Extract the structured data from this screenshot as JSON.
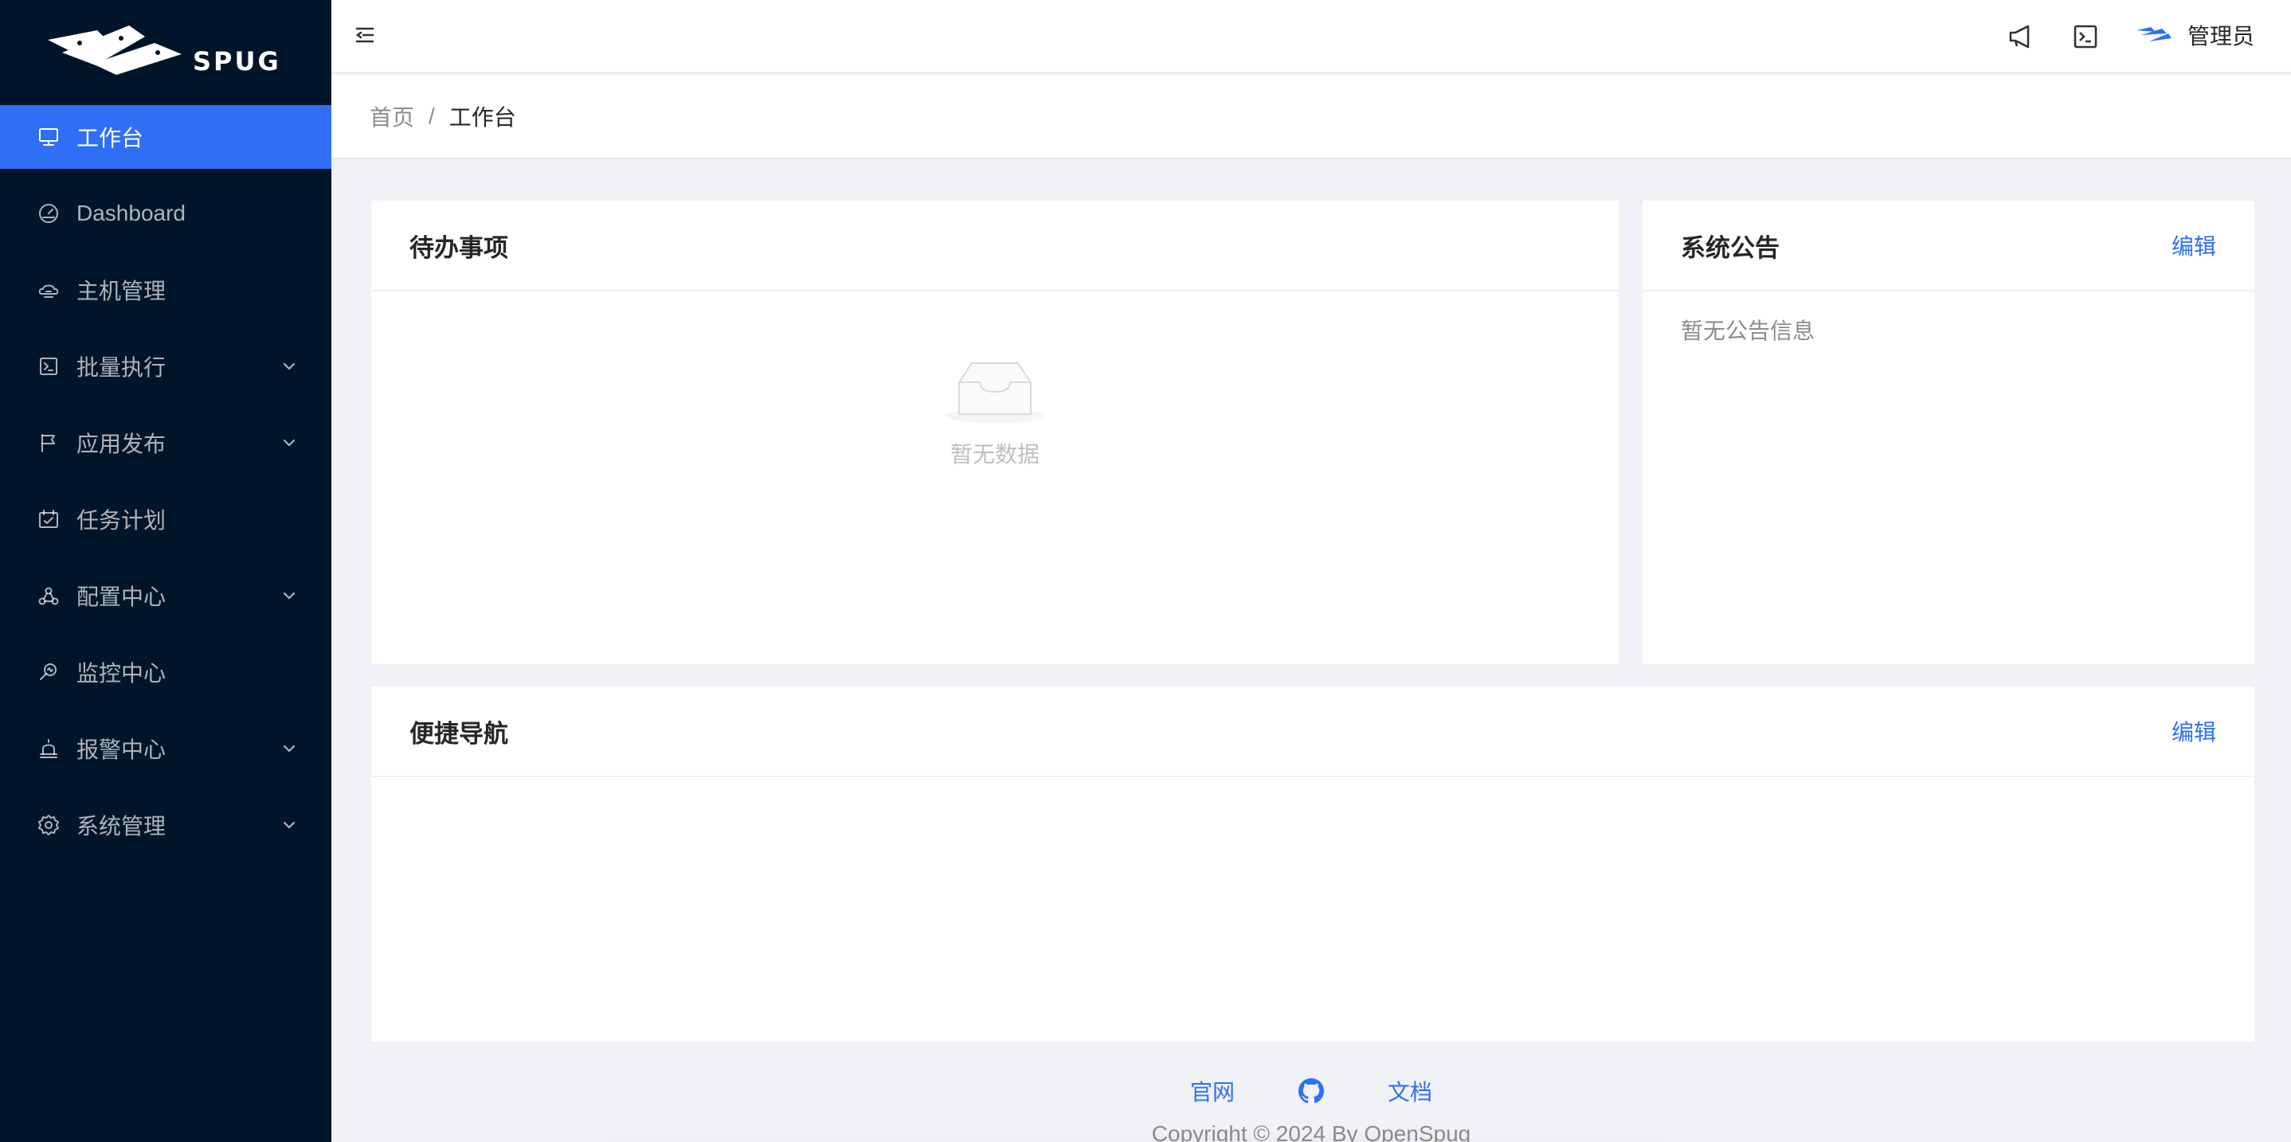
{
  "brand": {
    "name": "SPUG"
  },
  "sidebar": {
    "items": [
      {
        "label": "工作台",
        "icon": "desktop-icon",
        "active": true,
        "expandable": false
      },
      {
        "label": "Dashboard",
        "icon": "dashboard-icon",
        "active": false,
        "expandable": false
      },
      {
        "label": "主机管理",
        "icon": "cloud-server-icon",
        "active": false,
        "expandable": false
      },
      {
        "label": "批量执行",
        "icon": "code-icon",
        "active": false,
        "expandable": true
      },
      {
        "label": "应用发布",
        "icon": "flag-icon",
        "active": false,
        "expandable": true
      },
      {
        "label": "任务计划",
        "icon": "schedule-icon",
        "active": false,
        "expandable": false
      },
      {
        "label": "配置中心",
        "icon": "deployment-unit-icon",
        "active": false,
        "expandable": true
      },
      {
        "label": "监控中心",
        "icon": "monitor-icon",
        "active": false,
        "expandable": false
      },
      {
        "label": "报警中心",
        "icon": "alert-icon",
        "active": false,
        "expandable": true
      },
      {
        "label": "系统管理",
        "icon": "setting-icon",
        "active": false,
        "expandable": true
      }
    ]
  },
  "header": {
    "user_name": "管理员",
    "icons": [
      "menu-fold-icon",
      "notification-icon",
      "terminal-icon",
      "avatar-icon"
    ]
  },
  "breadcrumb": {
    "home": "首页",
    "separator": "/",
    "current": "工作台"
  },
  "todo": {
    "title": "待办事项",
    "empty_text": "暂无数据"
  },
  "notice": {
    "title": "系统公告",
    "edit": "编辑",
    "empty_text": "暂无公告信息"
  },
  "nav": {
    "title": "便捷导航",
    "edit": "编辑"
  },
  "footer": {
    "official": "官网",
    "docs": "文档",
    "copyright": "Copyright © 2024 By OpenSpug"
  },
  "colors": {
    "primary": "#2f6ff5",
    "sidebar_bg": "#001529",
    "page_bg": "#f0f2f5"
  }
}
